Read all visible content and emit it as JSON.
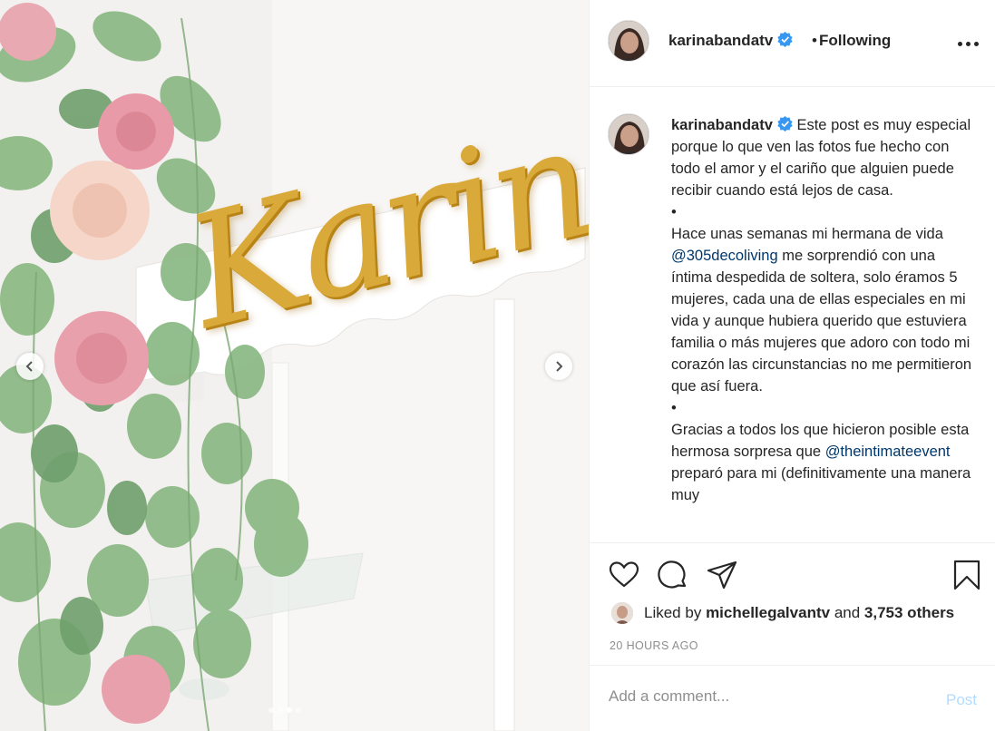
{
  "media": {
    "sign_text": "Karina",
    "carousel": {
      "count": 4,
      "active_index": 2
    },
    "prev_icon": "chevron-left-icon",
    "next_icon": "chevron-right-icon"
  },
  "header": {
    "username": "karinabandatv",
    "separator": "•",
    "follow_state": "Following",
    "verified_icon": "verified-badge-icon",
    "more_icon": "more-options-icon"
  },
  "caption": {
    "username": "karinabandatv",
    "p1": "Este post es muy especial porque lo que ven las fotos fue hecho con todo el amor y el cariño que alguien puede recibir cuando está lejos de casa.",
    "bullet": "•",
    "p2_before": "Hace unas semanas mi hermana de vida ",
    "p2_mention": "@305decoliving",
    "p2_after": " me sorprendió con una íntima despedida de soltera, solo éramos 5 mujeres, cada una de ellas especiales en mi vida y aunque hubiera querido que estuviera familia o más mujeres que adoro con todo mi corazón las circunstancias no me permitieron que así fuera.",
    "bullet2": "•",
    "p3_before": "Gracias a todos los que hicieron posible esta hermosa sorpresa que ",
    "p3_mention": "@theintimateevent",
    "p3_after": " preparó para mi (definitivamente una manera muy"
  },
  "actions": {
    "like_icon": "heart-icon",
    "comment_icon": "comment-icon",
    "share_icon": "paper-plane-icon",
    "save_icon": "bookmark-icon"
  },
  "likes": {
    "prefix": "Liked by",
    "user": "michellegalvantv",
    "conjunction": "and",
    "others": "3,753 others"
  },
  "timestamp": "20 HOURS AGO",
  "comment_box": {
    "placeholder": "Add a comment...",
    "post_label": "Post"
  },
  "colors": {
    "text": "#262626",
    "muted": "#8e8e8e",
    "mention": "#00376b",
    "verified": "#3897f0",
    "post_disabled": "#b3dbff",
    "gold_sign": "#d9a93a",
    "rose_pink": "#e99aa8",
    "rose_peach": "#f5d3c4",
    "leaf": "#8dba86"
  }
}
